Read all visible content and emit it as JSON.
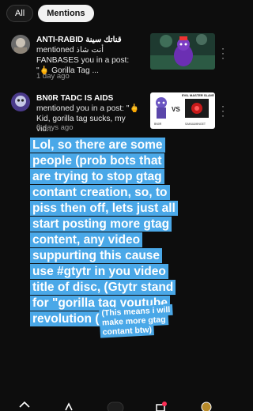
{
  "tabs": [
    {
      "label": "All",
      "active": false
    },
    {
      "label": "Mentions",
      "active": true
    }
  ],
  "notifications": [
    {
      "username": "ANTI-RABID قناتك سينة",
      "body": "mentioned أنت شاذ FANBASES you in a post: \"🖕 Gorilla Tag ...",
      "time": "1 day ago",
      "thumbnail": "gorilla-tag-thumbnail"
    },
    {
      "username": "BN0R TADC IS AIDS",
      "body": "mentioned you in a post: \"🖕 Kid, gorilla tag sucks, my vid...",
      "time": "8 days ago",
      "thumbnail_title": "EVIL MASTER SLAVE",
      "thumbnail_vs": "VS",
      "thumbnail_left": "BN0R",
      "thumbnail_right": "SAMU&MINGET"
    }
  ],
  "caption_main": "Lol, so there are some people (prob bots that are trying to stop gtag contant creation, so, to piss then off, lets just all start posting more gtag content, any video suppurting this cause use #gtytr in you video title of disc, (Gtytr stand for \"gorilla tag youtube revolution (",
  "caption_note": "(This means i will make more gtag contant btw)",
  "colors": {
    "caption_bg": "#4aa8e8",
    "background": "#0d0d0d"
  }
}
